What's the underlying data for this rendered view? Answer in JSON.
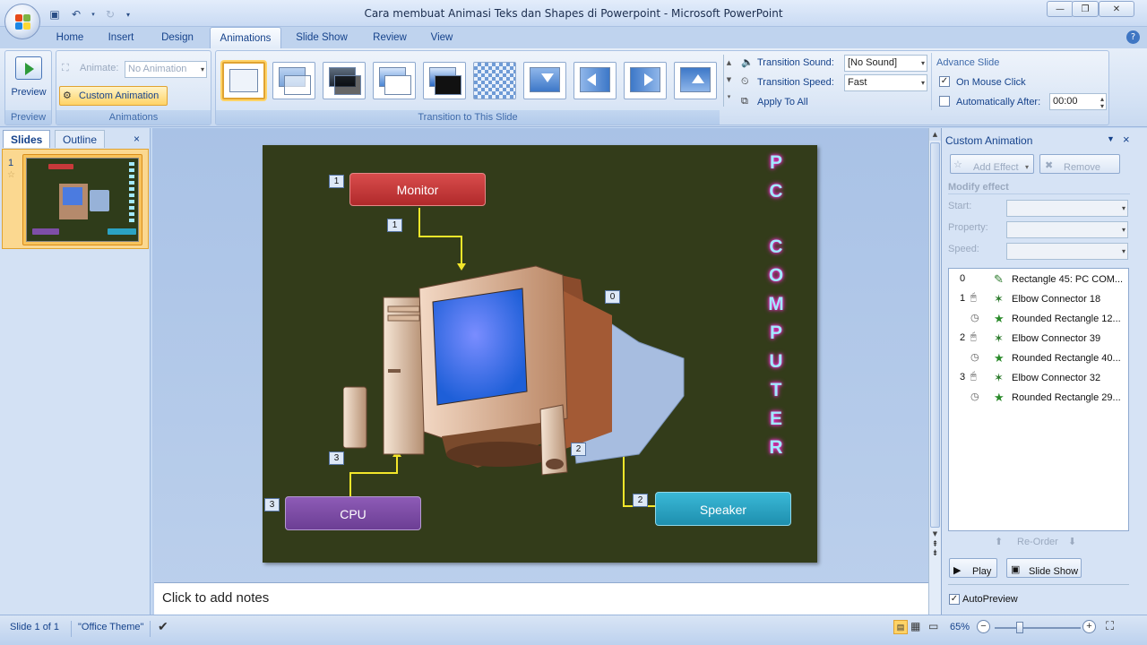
{
  "window": {
    "title": "Cara membuat Animasi Teks dan Shapes di Powerpoint - Microsoft PowerPoint"
  },
  "tabs": [
    "Home",
    "Insert",
    "Design",
    "Animations",
    "Slide Show",
    "Review",
    "View"
  ],
  "active_tab": "Animations",
  "ribbon": {
    "preview": {
      "button_label": "Preview",
      "group_label": "Preview"
    },
    "animations": {
      "animate_label": "Animate:",
      "animate_value": "No Animation",
      "custom_animation_label": "Custom Animation",
      "group_label": "Animations"
    },
    "transition": {
      "group_label": "Transition to This Slide",
      "sound_label": "Transition Sound:",
      "sound_value": "[No Sound]",
      "speed_label": "Transition Speed:",
      "speed_value": "Fast",
      "apply_all_label": "Apply To All"
    },
    "advance": {
      "title": "Advance Slide",
      "on_click_label": "On Mouse Click",
      "on_click_checked": true,
      "auto_label": "Automatically After:",
      "auto_checked": false,
      "auto_value": "00:00"
    }
  },
  "left_pane": {
    "tab_slides": "Slides",
    "tab_outline": "Outline",
    "slide_number": "1"
  },
  "slide": {
    "monitor_label": "Monitor",
    "cpu_label": "CPU",
    "speaker_label": "Speaker",
    "vertical_text": [
      "P",
      "C",
      "C",
      "O",
      "M",
      "P",
      "U",
      "T",
      "E",
      "R"
    ],
    "tags": {
      "t_monitor": "1",
      "t_monitor_arrow": "1",
      "t_screen": "0",
      "t_cpu": "3",
      "t_cpu_arrow": "3",
      "t_speaker_arrow": "2",
      "t_speaker": "2"
    }
  },
  "notes_placeholder": "Click to add notes",
  "custom_animation": {
    "title": "Custom Animation",
    "add_effect": "Add Effect",
    "remove": "Remove",
    "modify_effect": "Modify effect",
    "start_label": "Start:",
    "property_label": "Property:",
    "speed_label": "Speed:",
    "items": [
      {
        "num": "0",
        "name": "Rectangle 45: PC COM..."
      },
      {
        "num": "1",
        "name": "Elbow Connector 18"
      },
      {
        "num": "",
        "name": "Rounded Rectangle 12..."
      },
      {
        "num": "2",
        "name": "Elbow Connector 39"
      },
      {
        "num": "",
        "name": "Rounded Rectangle 40..."
      },
      {
        "num": "3",
        "name": "Elbow Connector 32"
      },
      {
        "num": "",
        "name": "Rounded Rectangle 29..."
      }
    ],
    "reorder_label": "Re-Order",
    "play_label": "Play",
    "slideshow_label": "Slide Show",
    "autopreview_label": "AutoPreview",
    "autopreview_checked": true
  },
  "status": {
    "slide_info": "Slide 1 of 1",
    "theme": "\"Office Theme\"",
    "zoom": "65%"
  },
  "colors": {
    "slide_bg": "#333c1a",
    "monitor_box": "#c8393a",
    "cpu_box": "#7e4ea6",
    "speaker_box": "#2ba3c4",
    "connector": "#f3e62a",
    "vertical_text": "#a2e9ff",
    "vertical_glow": "#ff2ad6"
  }
}
